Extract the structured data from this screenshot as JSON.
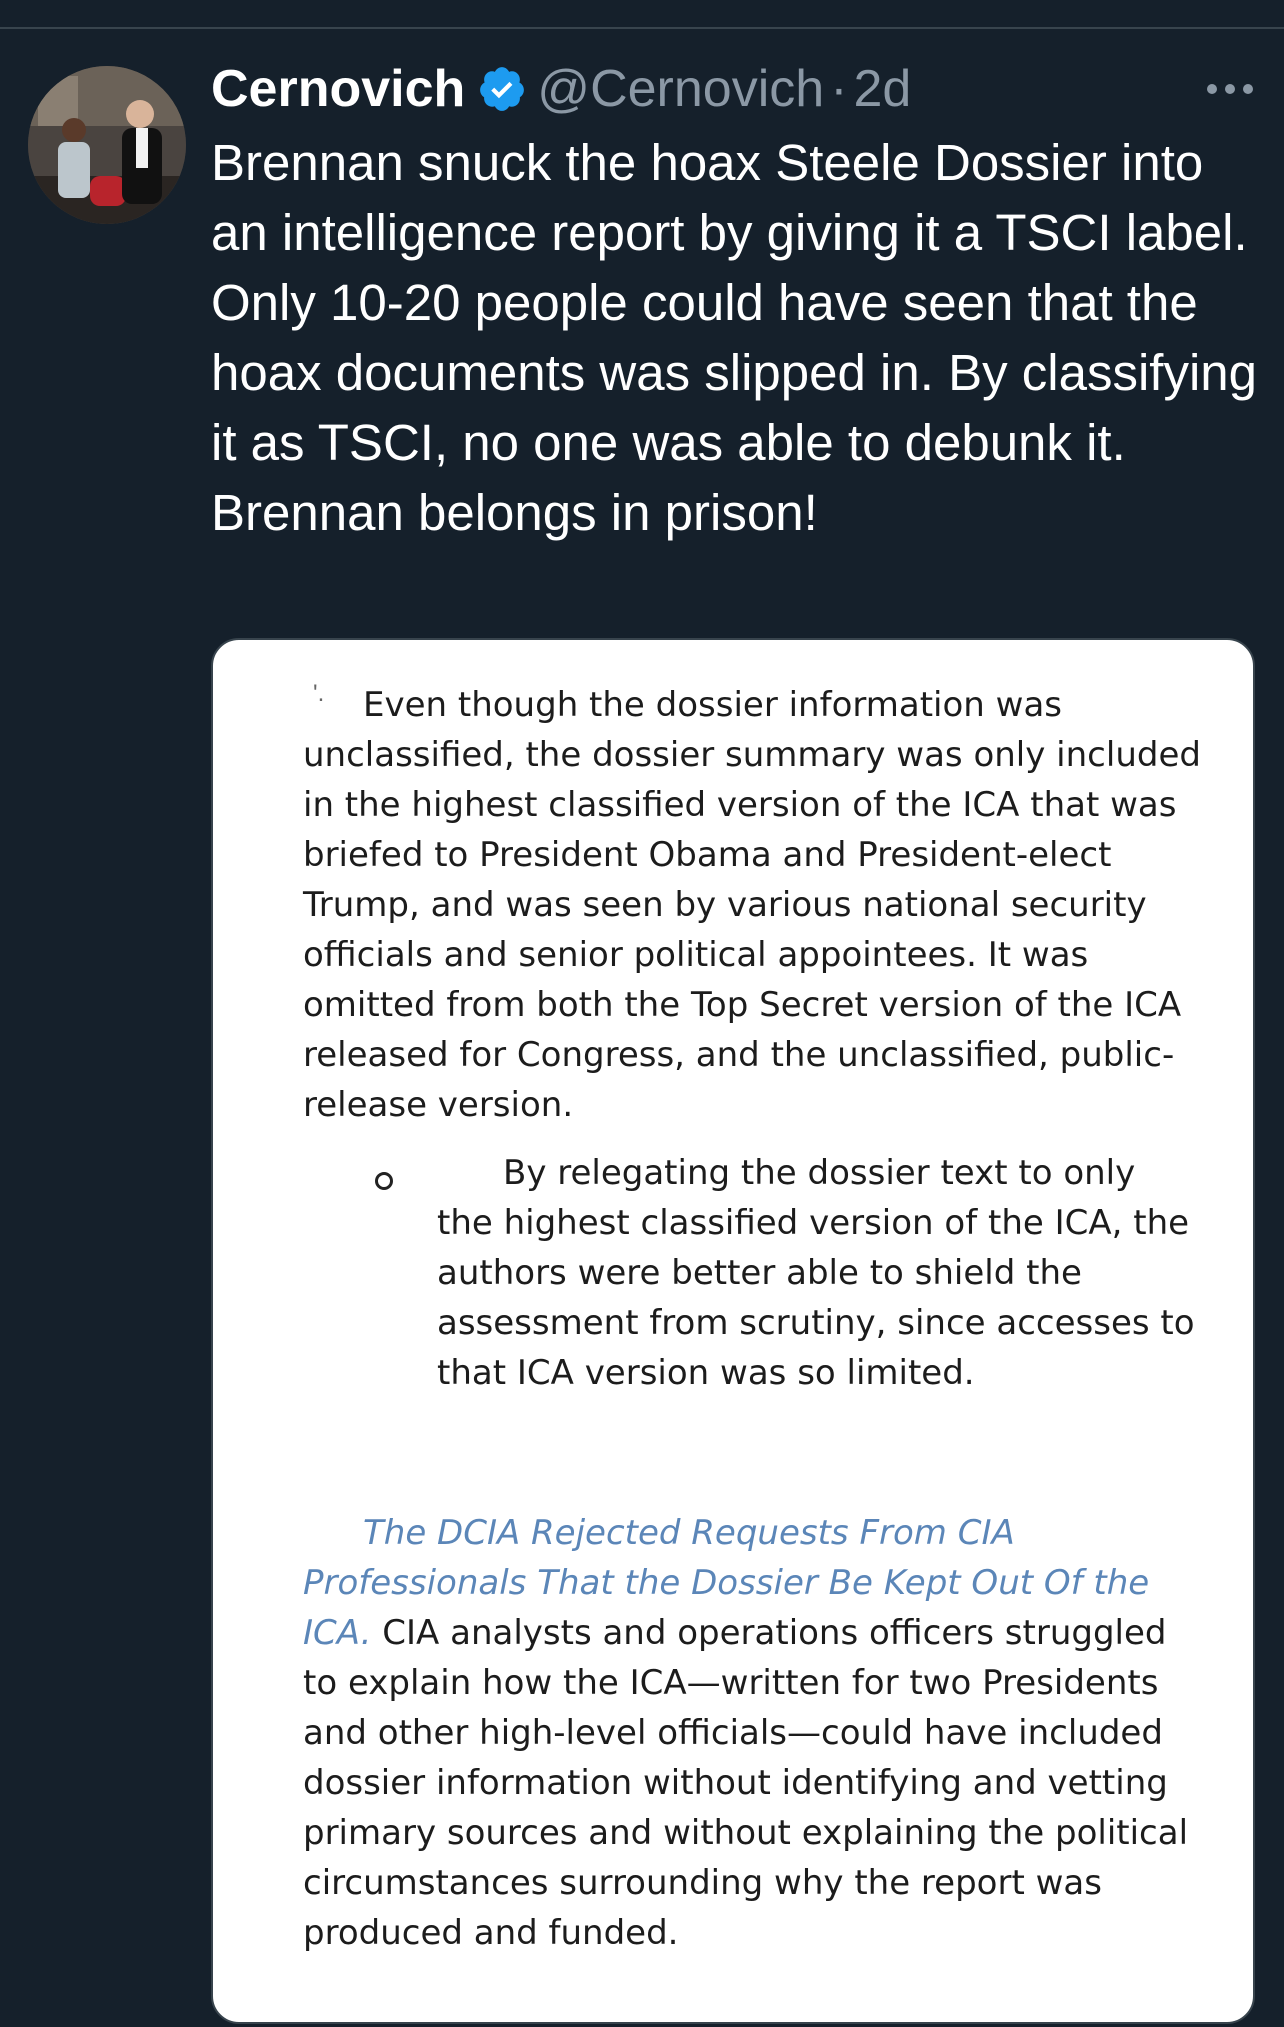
{
  "tweet": {
    "author": {
      "display_name": "Cernovich",
      "handle": "@Cernovich",
      "verified_icon": "verified-badge-icon"
    },
    "separator": "·",
    "time": "2d",
    "more_icon": "more-horizontal-icon",
    "text": "Brennan snuck the hoax Steele Dossier into an intelligence report by giving it a TSCI label. Only 10-20 people could have seen that the hoax documents was slipped in. By classifying it as TSCI, no one was able to debunk it. Brennan belongs in prison!",
    "media": {
      "paragraph1": "Even though the dossier information was unclassified, the dossier summary was only included in the highest classified version of the ICA that was briefed to President Obama and President-elect Trump, and was seen by various national security officials and senior political appointees. It was omitted from both the Top Secret version of the ICA released for Congress, and the unclassified, public-release version.",
      "bullet": "By relegating the dossier text to only the highest classified version of the ICA, the authors were better able to shield the assessment from scrutiny, since accesses to that ICA version was so limited.",
      "heading": "The DCIA Rejected Requests From CIA Professionals That the Dossier Be Kept Out Of the ICA.",
      "paragraph3": "CIA analysts and operations officers struggled to explain how the ICA—written for two Presidents and other high-level officials—could have included dossier information without identifying and vetting primary sources and without explaining the political circumstances surrounding why the report was produced and funded."
    }
  },
  "colors": {
    "background": "#15202b",
    "secondary_text": "#8b98a5",
    "verified_blue": "#1d9bf0",
    "heading_blue": "#5b86b8"
  }
}
